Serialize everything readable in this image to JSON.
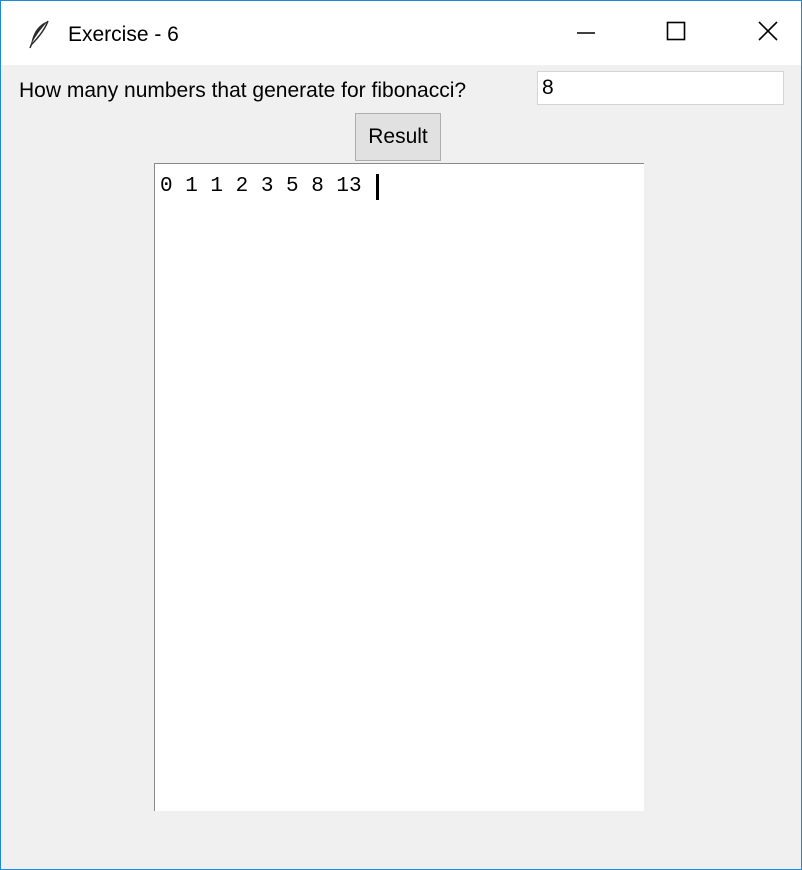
{
  "window": {
    "title": "Exercise - 6",
    "app_icon": "feather-icon",
    "controls": {
      "minimize_icon": "minimize-icon",
      "maximize_icon": "maximize-icon",
      "close_icon": "close-icon"
    }
  },
  "form": {
    "prompt_label": "How many numbers that generate for fibonacci?",
    "count_value": "8",
    "result_button_label": "Result"
  },
  "output": {
    "text": "0 1 1 2 3 5 8 13 "
  },
  "colors": {
    "window_border": "#1e8ad6",
    "background": "#f0f0f0",
    "button_bg": "#e1e1e1",
    "output_bg": "#ffffff"
  }
}
